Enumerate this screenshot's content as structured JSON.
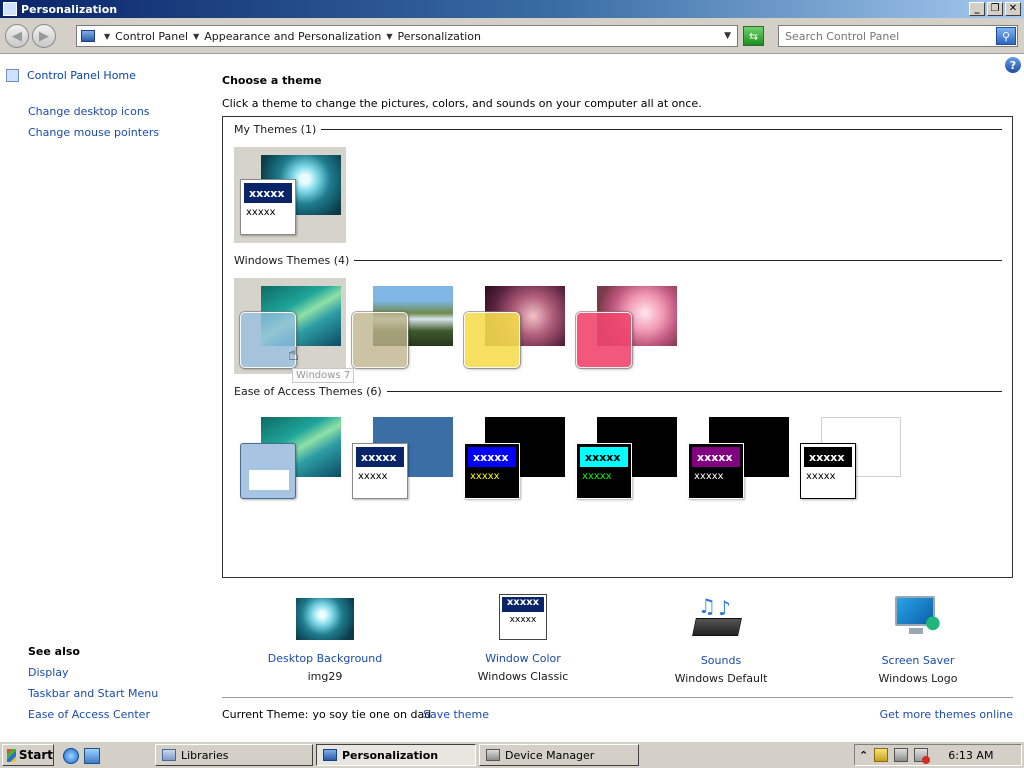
{
  "window": {
    "title": "Personalization",
    "controls": [
      "_",
      "❐",
      "✕"
    ]
  },
  "address": {
    "breadcrumbs": [
      "Control Panel",
      "Appearance and Personalization",
      "Personalization"
    ],
    "search_placeholder": "Search Control Panel"
  },
  "left": {
    "home": "Control Panel Home",
    "links": [
      "Change desktop icons",
      "Change mouse pointers"
    ],
    "see_also": "See also",
    "see_also_links": [
      "Display",
      "Taskbar and Start Menu",
      "Ease of Access Center"
    ]
  },
  "main": {
    "heading": "Choose a theme",
    "subtitle": "Click a theme to change the pictures, colors, and sounds on your computer all at once.",
    "sections": {
      "my_themes": "My Themes (1)",
      "windows_themes": "Windows Themes (4)",
      "ease_themes": "Ease of Access Themes (6)"
    },
    "tooltip": "Windows 7",
    "mini_title": "xxxxx",
    "mini_body": "xxxxx"
  },
  "settings": [
    {
      "name": "Desktop Background",
      "value": "img29",
      "icon": "desktop-background-icon"
    },
    {
      "name": "Window Color",
      "value": "Windows Classic",
      "icon": "window-color-icon"
    },
    {
      "name": "Sounds",
      "value": "Windows Default",
      "icon": "sounds-icon"
    },
    {
      "name": "Screen Saver",
      "value": "Windows Logo",
      "icon": "screen-saver-icon"
    }
  ],
  "footer": {
    "current_label": "Current Theme:",
    "current_value": "yo soy tie one on dad",
    "save": "Save theme",
    "get_more": "Get more themes online"
  },
  "taskbar": {
    "start": "Start",
    "tasks": [
      "Libraries",
      "Personalization",
      "Device Manager"
    ],
    "clock": "6:13 AM"
  }
}
